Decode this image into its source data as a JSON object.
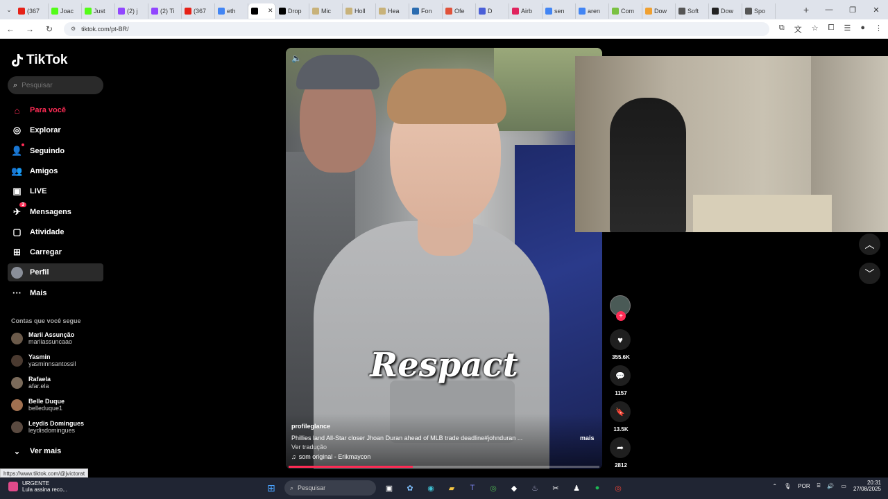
{
  "browser": {
    "tabs": [
      {
        "title": "(367",
        "color": "#e62117"
      },
      {
        "title": "Joac",
        "color": "#53fc18"
      },
      {
        "title": "Just",
        "color": "#53fc18"
      },
      {
        "title": "(2) j",
        "color": "#9146ff"
      },
      {
        "title": "(2) Ti",
        "color": "#9146ff"
      },
      {
        "title": "(367",
        "color": "#e62117"
      },
      {
        "title": "eth",
        "color": "#4285f4"
      },
      {
        "title": "",
        "color": "#000000"
      },
      {
        "title": "Drop",
        "color": "#000000"
      },
      {
        "title": "Mic",
        "color": "#c8b27a"
      },
      {
        "title": "Holl",
        "color": "#c8b27a"
      },
      {
        "title": "Hea",
        "color": "#c8b27a"
      },
      {
        "title": "Fon",
        "color": "#2b6cb0"
      },
      {
        "title": "Ofe",
        "color": "#e0523a"
      },
      {
        "title": "D",
        "color": "#4a5fd8"
      },
      {
        "title": "Airb",
        "color": "#e0245e"
      },
      {
        "title": "sen",
        "color": "#4285f4"
      },
      {
        "title": "aren",
        "color": "#4285f4"
      },
      {
        "title": "Com",
        "color": "#7ac142"
      },
      {
        "title": "Dow",
        "color": "#f0a030"
      },
      {
        "title": "Soft",
        "color": "#555555"
      },
      {
        "title": "Dow",
        "color": "#222222"
      },
      {
        "title": "Spo",
        "color": "#555555"
      }
    ],
    "new_tab": "+",
    "url": "tiktok.com/pt-BR/"
  },
  "sidebar": {
    "logo": "TikTok",
    "search_placeholder": "Pesquisar",
    "nav": [
      {
        "label": "Para você",
        "icon": "home-icon",
        "active": true
      },
      {
        "label": "Explorar",
        "icon": "compass-icon"
      },
      {
        "label": "Seguindo",
        "icon": "following-icon",
        "dot": true
      },
      {
        "label": "Amigos",
        "icon": "friends-icon"
      },
      {
        "label": "LIVE",
        "icon": "live-icon"
      },
      {
        "label": "Mensagens",
        "icon": "messages-icon",
        "badge": "3"
      },
      {
        "label": "Atividade",
        "icon": "activity-icon"
      },
      {
        "label": "Carregar",
        "icon": "upload-icon"
      },
      {
        "label": "Perfil",
        "icon": "profile-avatar-icon",
        "hover": true
      },
      {
        "label": "Mais",
        "icon": "more-icon"
      }
    ],
    "following_title": "Contas que você segue",
    "accounts": [
      {
        "name": "Marii Assunção",
        "user": "mariiassuncaao"
      },
      {
        "name": "Yasmin",
        "user": "yasminnsantossil"
      },
      {
        "name": "Rafaela",
        "user": "afar.ela"
      },
      {
        "name": "Belle Duque",
        "user": "belleduque1"
      },
      {
        "name": "Leydis Domingues",
        "user": "leydisdomingues"
      }
    ],
    "see_more": "Ver mais"
  },
  "video": {
    "overlay_text": "Respact",
    "author": "profileglance",
    "description": "Phillies land All-Star closer Jhoan Duran ahead of MLB trade deadline#johnduran ...",
    "more": "mais",
    "translate": "Ver tradução",
    "sound": "som original - Erikmaycon",
    "progress": 0.4
  },
  "actions": {
    "likes": "355.6K",
    "comments": "1157",
    "saves": "13.5K",
    "shares": "2812"
  },
  "status_link": "https://www.tiktok.com/@jvictorat",
  "taskbar": {
    "news_title": "URGENTE",
    "news_sub": "Lula assina reco...",
    "search": "Pesquisar",
    "lang": "POR",
    "time": "20:31",
    "date": "27/08/2025"
  }
}
